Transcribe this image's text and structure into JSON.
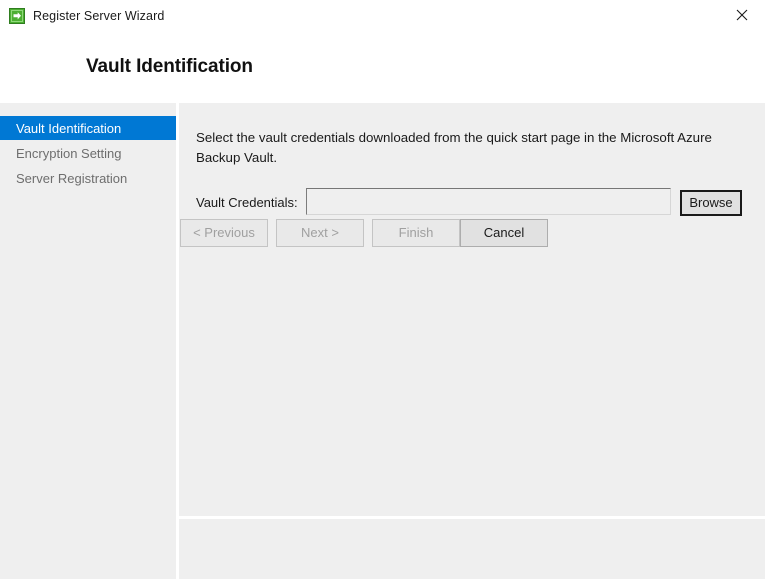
{
  "window": {
    "title": "Register Server Wizard",
    "icon": "green-arrow-icon",
    "close_label": "×"
  },
  "header": {
    "page_title": "Vault Identification"
  },
  "sidebar": {
    "items": [
      {
        "label": "Vault Identification",
        "selected": true
      },
      {
        "label": "Encryption Setting",
        "selected": false
      },
      {
        "label": "Server Registration",
        "selected": false
      }
    ]
  },
  "content": {
    "instruction": "Select the vault credentials downloaded from the quick start page in the Microsoft Azure Backup Vault.",
    "field_label": "Vault Credentials:",
    "field_value": "",
    "field_placeholder": "",
    "browse_label": "Browse"
  },
  "footer": {
    "previous_label": "< Previous",
    "next_label": "Next >",
    "finish_label": "Finish",
    "cancel_label": "Cancel"
  },
  "colors": {
    "accent": "#0078d4",
    "panel": "#efefef",
    "titlebar": "#ffffff",
    "icon_green": "#4caf32",
    "disabled_text": "#a0a0a0"
  }
}
